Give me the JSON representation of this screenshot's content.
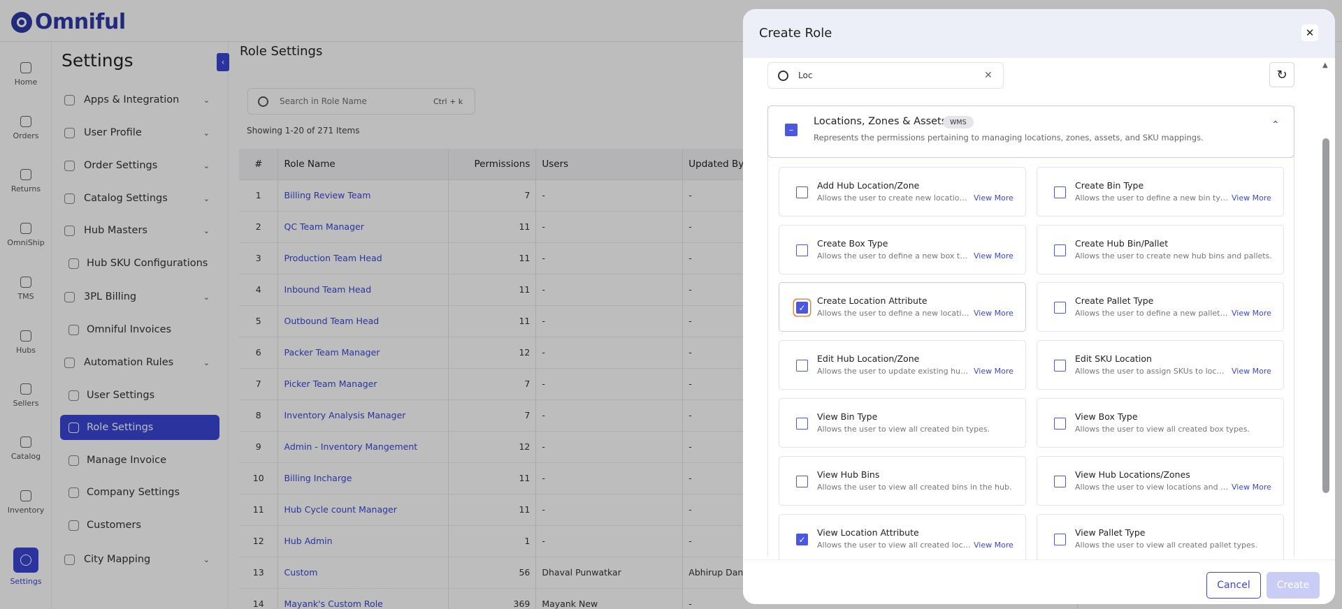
{
  "app": {
    "logo_text": "Omniful"
  },
  "rail": {
    "items": [
      {
        "label": "Home",
        "icon": "home-icon"
      },
      {
        "label": "Orders",
        "icon": "orders-icon"
      },
      {
        "label": "Returns",
        "icon": "returns-icon"
      },
      {
        "label": "OmniShip",
        "icon": "omniship-icon"
      },
      {
        "label": "TMS",
        "icon": "truck-icon"
      },
      {
        "label": "Hubs",
        "icon": "hubs-icon"
      },
      {
        "label": "Sellers",
        "icon": "sellers-icon"
      },
      {
        "label": "Catalog",
        "icon": "catalog-icon"
      },
      {
        "label": "Inventory",
        "icon": "inventory-icon"
      },
      {
        "label": "Settings",
        "icon": "gear-icon",
        "active": true
      }
    ]
  },
  "sidebar": {
    "title": "Settings",
    "collapse_icon": "chevron-left-icon",
    "items": [
      {
        "label": "Apps & Integration",
        "chevron": true
      },
      {
        "label": "User Profile",
        "chevron": true
      },
      {
        "label": "Order Settings",
        "chevron": true
      },
      {
        "label": "Catalog Settings",
        "chevron": true
      },
      {
        "label": "Hub Masters",
        "chevron": true
      },
      {
        "label": "Hub SKU Configurations",
        "sub": true
      },
      {
        "label": "3PL Billing",
        "chevron": true
      },
      {
        "label": "Omniful Invoices",
        "sub": true
      },
      {
        "label": "Automation Rules",
        "chevron": true
      },
      {
        "label": "User Settings",
        "sub": true
      },
      {
        "label": "Role Settings",
        "sub": true,
        "active": true
      },
      {
        "label": "Manage Invoice",
        "sub": true
      },
      {
        "label": "Company Settings",
        "sub": true
      },
      {
        "label": "Customers",
        "sub": true
      },
      {
        "label": "City Mapping",
        "chevron": true
      }
    ]
  },
  "main": {
    "title": "Role Settings",
    "search": {
      "placeholder": "Search in Role Name",
      "shortcut": "Ctrl + k"
    },
    "showing": "Showing 1-20 of 271 Items",
    "table": {
      "headers": [
        "#",
        "Role Name",
        "Permissions",
        "Users",
        "Updated By"
      ],
      "rows": [
        [
          "1",
          "Billing Review Team",
          "7",
          "-",
          "-"
        ],
        [
          "2",
          "QC Team Manager",
          "11",
          "-",
          "-"
        ],
        [
          "3",
          "Production Team Head",
          "11",
          "-",
          "-"
        ],
        [
          "4",
          "Inbound Team Head",
          "11",
          "-",
          "-"
        ],
        [
          "5",
          "Outbound Team Head",
          "11",
          "-",
          "-"
        ],
        [
          "6",
          "Packer Team Manager",
          "12",
          "-",
          "-"
        ],
        [
          "7",
          "Picker Team Manager",
          "7",
          "-",
          "-"
        ],
        [
          "8",
          "Inventory Analysis Manager",
          "7",
          "-",
          "-"
        ],
        [
          "9",
          "Admin - Inventory Mangement",
          "12",
          "-",
          "-"
        ],
        [
          "10",
          "Billing Incharge",
          "11",
          "-",
          "-"
        ],
        [
          "11",
          "Hub Cycle count Manager",
          "11",
          "-",
          "-"
        ],
        [
          "12",
          "Hub Admin",
          "1",
          "-",
          "-"
        ],
        [
          "13",
          "Custom",
          "56",
          "Dhaval Punwatkar",
          "Abhirup Dande"
        ],
        [
          "14",
          "Mayank's Custom Role",
          "369",
          "Mayank New",
          "-"
        ]
      ]
    }
  },
  "modal": {
    "title": "Create Role",
    "close_icon": "close-icon",
    "search": {
      "value": "Loc",
      "clear_icon": "close-icon"
    },
    "refresh_icon": "refresh-icon",
    "group": {
      "title": "Locations, Zones & Assets",
      "badge": "WMS",
      "description": "Represents the permissions pertaining to managing locations, zones, assets, and SKU mappings.",
      "state": "partial"
    },
    "permissions": [
      {
        "title": "Add Hub Location/Zone",
        "desc": "Allows the user to create new locations and zones.",
        "more": "View More",
        "checked": false
      },
      {
        "title": "Create Bin Type",
        "desc": "Allows the user to define a new bin type for the hub.",
        "more": "View More",
        "checked": false
      },
      {
        "title": "Create Box Type",
        "desc": "Allows the user to define a new box type for the hub.",
        "more": "View More",
        "checked": false
      },
      {
        "title": "Create Hub Bin/Pallet",
        "desc": "Allows the user to create new hub bins and pallets.",
        "more": "",
        "checked": false
      },
      {
        "title": "Create Location Attribute",
        "desc": "Allows the user to define a new location attribute.",
        "more": "View More",
        "checked": true,
        "focused": true
      },
      {
        "title": "Create Pallet Type",
        "desc": "Allows the user to define a new pallet type for the hub.",
        "more": "View More",
        "checked": false
      },
      {
        "title": "Edit Hub Location/Zone",
        "desc": "Allows the user to update existing hub locations and zones.",
        "more": "View More",
        "checked": false
      },
      {
        "title": "Edit SKU Location",
        "desc": "Allows the user to assign SKUs to locations in the hub.",
        "more": "View More",
        "checked": false
      },
      {
        "title": "View Bin Type",
        "desc": "Allows the user to view all created bin types.",
        "more": "",
        "checked": false
      },
      {
        "title": "View Box Type",
        "desc": "Allows the user to view all created box types.",
        "more": "",
        "checked": false
      },
      {
        "title": "View Hub Bins",
        "desc": "Allows the user to view all created bins in the hub.",
        "more": "",
        "checked": false
      },
      {
        "title": "View Hub Locations/Zones",
        "desc": "Allows the user to view locations and zones in the hub.",
        "more": "View More",
        "checked": false
      },
      {
        "title": "View Location Attribute",
        "desc": "Allows the user to view all created location attributes.",
        "more": "View More",
        "checked": true
      },
      {
        "title": "View Pallet Type",
        "desc": "Allows the user to view all created pallet types.",
        "more": "",
        "checked": false
      }
    ],
    "footer": {
      "cancel": "Cancel",
      "create": "Create"
    }
  }
}
